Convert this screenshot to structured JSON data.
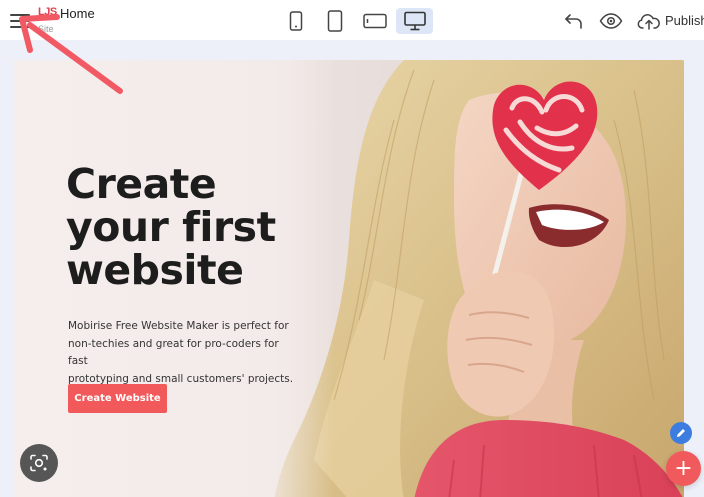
{
  "header": {
    "logo_mark": "LJS",
    "page_name": "Home",
    "site_label": "Site",
    "publish_label": "Publish"
  },
  "device_modes": [
    {
      "name": "phone-portrait",
      "active": false
    },
    {
      "name": "tablet-portrait",
      "active": false
    },
    {
      "name": "tablet-landscape",
      "active": false
    },
    {
      "name": "desktop",
      "active": true
    }
  ],
  "hero": {
    "title_lines": [
      "Create",
      "your first",
      "website"
    ],
    "description_lines": [
      "Mobirise Free Website Maker is perfect for",
      "non-techies and great for pro-coders for fast",
      "prototyping and small customers' projects."
    ],
    "cta_label": "Create Website"
  },
  "colors": {
    "accent": "#f2595b",
    "active_device": "#dde6f7",
    "canvas_bg": "#edf0f8",
    "annotation_arrow": "#f15a64",
    "edit_fab": "#3d7de0",
    "add_fab": "#f05a5c"
  },
  "icons": {
    "menu": "hamburger-icon",
    "undo": "undo-arrow-icon",
    "preview": "eye-icon",
    "publish": "cloud-upload-icon",
    "edit": "pencil-icon",
    "add": "plus-icon",
    "lens": "camera-search-icon"
  }
}
